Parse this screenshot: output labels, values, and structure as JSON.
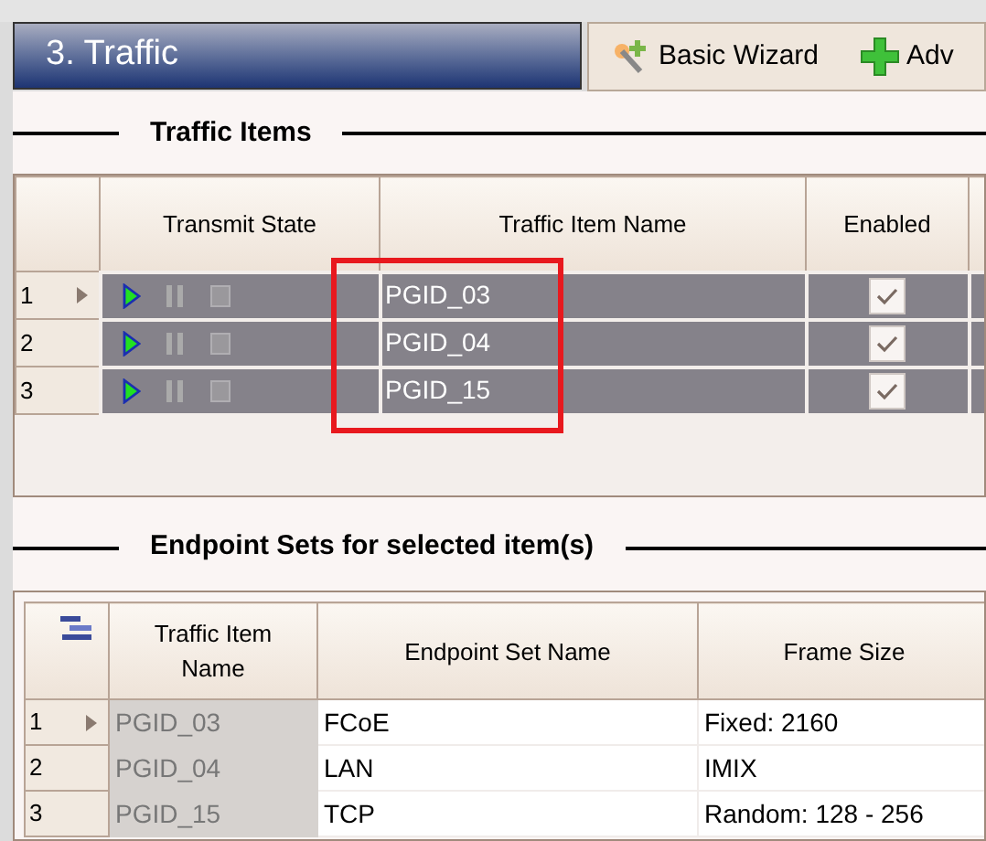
{
  "header": {
    "title": "3. Traffic"
  },
  "toolbar": [
    {
      "label": "Basic Wizard",
      "kind": "wand"
    },
    {
      "label": "Adv",
      "kind": "plus"
    }
  ],
  "traffic_items": {
    "heading": "Traffic Items",
    "columns": [
      "Transmit State",
      "Traffic Item Name",
      "Enabled"
    ],
    "rows": [
      {
        "number": "1",
        "current": true,
        "selected": true,
        "name": "PGID_03",
        "enabled": true
      },
      {
        "number": "2",
        "current": false,
        "selected": true,
        "name": "PGID_04",
        "enabled": true
      },
      {
        "number": "3",
        "current": false,
        "selected": true,
        "name": "PGID_15",
        "enabled": true
      }
    ]
  },
  "endpoint_sets": {
    "heading": "Endpoint Sets for selected item(s)",
    "columns": [
      "Traffic Item Name",
      "Endpoint Set Name",
      "Frame Size"
    ],
    "rows": [
      {
        "number": "1",
        "current": true,
        "traffic_item": "PGID_03",
        "endpoint_set": "FCoE",
        "frame_size": "Fixed: 2160"
      },
      {
        "number": "2",
        "current": false,
        "traffic_item": "PGID_04",
        "endpoint_set": "LAN",
        "frame_size": "IMIX"
      },
      {
        "number": "3",
        "current": false,
        "traffic_item": "PGID_15",
        "endpoint_set": "TCP",
        "frame_size": "Random: 128 - 256"
      }
    ]
  }
}
